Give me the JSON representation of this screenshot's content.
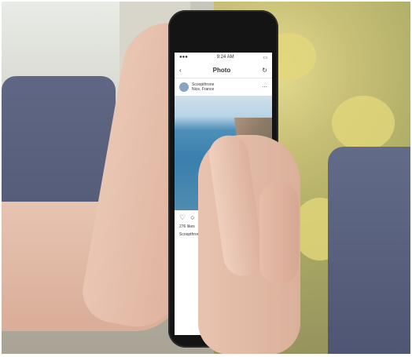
{
  "scene": {
    "description_colors": {
      "chair": "#5a617c",
      "skin": "#e1b8a3",
      "plant": "#c9c070",
      "phone": "#141414",
      "sea": "#3a7fae"
    }
  },
  "phone_screen": {
    "status_time": "9:24 AM",
    "nav_title": "Photo",
    "username": "Scoopthrone",
    "location": "Nice, France",
    "likes": "276 likes",
    "caption_user": "Scoopthrone"
  },
  "icons": [
    "back-chevron-icon",
    "refresh-icon",
    "heart-icon",
    "comment-icon",
    "share-icon",
    "more-dots-icon"
  ]
}
